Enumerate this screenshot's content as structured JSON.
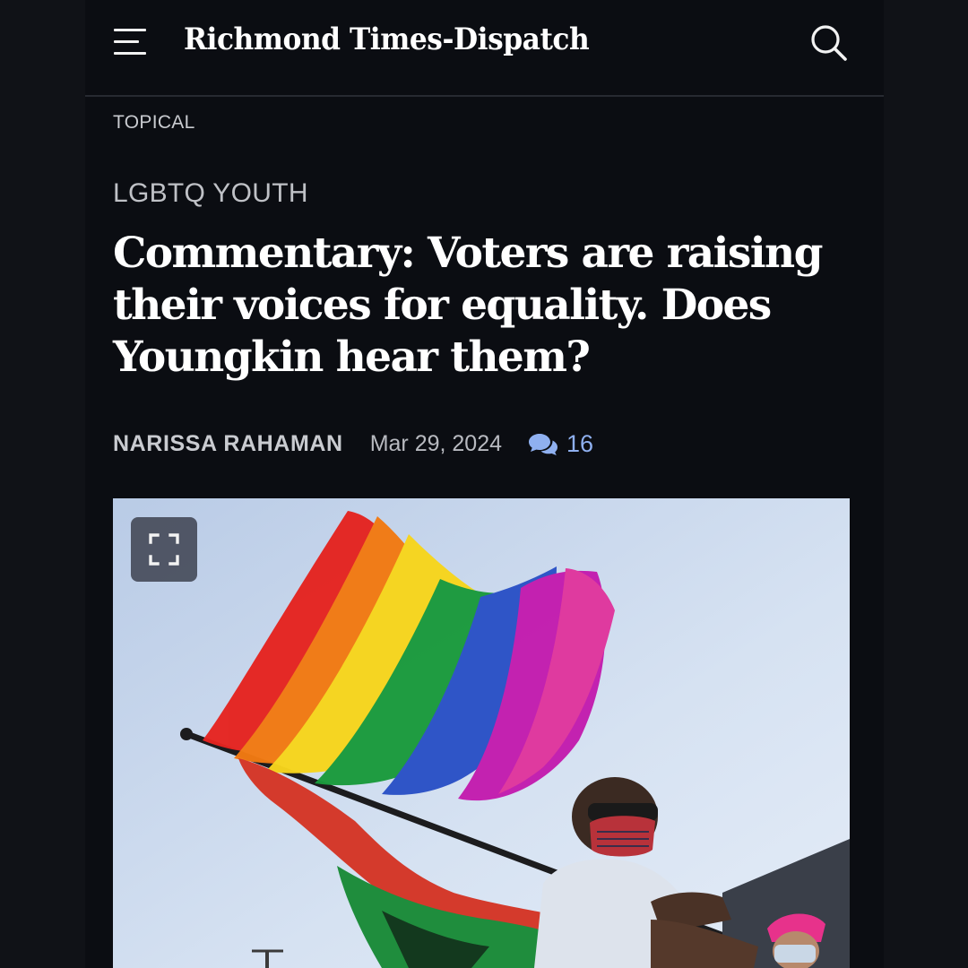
{
  "header": {
    "logo_text": "Richmond Times-Dispatch",
    "menu_icon": "hamburger-menu-icon",
    "search_icon": "search-icon"
  },
  "article": {
    "topical_label": "TOPICAL",
    "section_label": "LGBTQ YOUTH",
    "headline": "Commentary: Voters are raising their voices for equality. Does Youngkin hear them?",
    "author": "NARISSA RAHAMAN",
    "date": "Mar 29, 2024",
    "comment_count": "16",
    "comment_icon": "comments-icon",
    "comment_color": "#8fb0f0"
  },
  "photo": {
    "expand_icon": "fullscreen-expand-icon",
    "sky_color": "#cfdcf0"
  },
  "colors": {
    "background": "#0b0d12",
    "text_primary": "#ffffff",
    "text_secondary": "#c9cbd0"
  }
}
